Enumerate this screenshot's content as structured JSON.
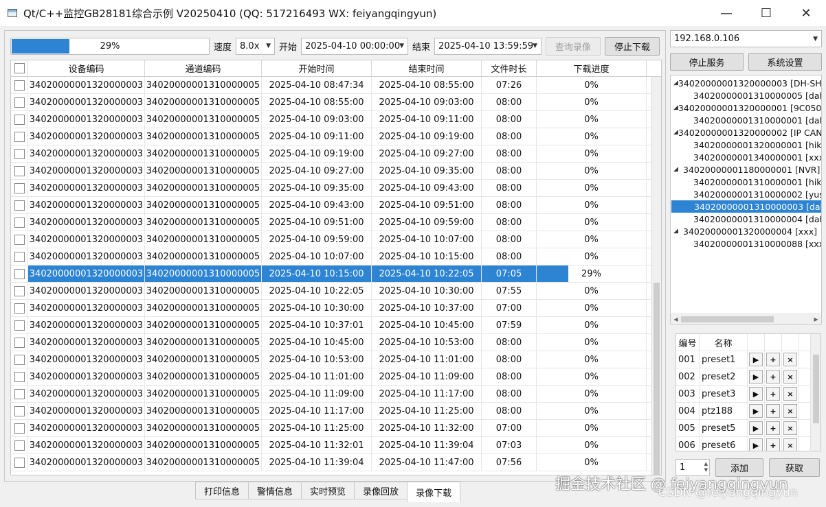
{
  "window": {
    "title": "Qt/C++监控GB28181综合示例 V20250410 (QQ: 517216493 WX: feiyangqingyun)",
    "minimize_glyph": "—",
    "maximize_glyph": "☐",
    "close_glyph": "✕"
  },
  "toolbar": {
    "progress_percent": 29,
    "progress_text": "29%",
    "speed_label": "速度",
    "speed_value": "8.0x",
    "start_label": "开始",
    "start_value": "2025-04-10 00:00:00",
    "end_label": "结束",
    "end_value": "2025-04-10 13:59:59",
    "query_button": "查询录像",
    "stop_download_button": "停止下载"
  },
  "table": {
    "headers": [
      "设备编码",
      "通道编码",
      "开始时间",
      "结束时间",
      "文件时长",
      "下载进度"
    ],
    "rows": [
      {
        "device": "34020000001320000003",
        "channel": "34020000001310000005",
        "start": "2025-04-10 08:47:34",
        "end": "2025-04-10 08:55:00",
        "duration": "07:26",
        "progress": "0%",
        "checked": false
      },
      {
        "device": "34020000001320000003",
        "channel": "34020000001310000005",
        "start": "2025-04-10 08:55:00",
        "end": "2025-04-10 09:03:00",
        "duration": "08:00",
        "progress": "0%",
        "checked": false
      },
      {
        "device": "34020000001320000003",
        "channel": "34020000001310000005",
        "start": "2025-04-10 09:03:00",
        "end": "2025-04-10 09:11:00",
        "duration": "08:00",
        "progress": "0%",
        "checked": false
      },
      {
        "device": "34020000001320000003",
        "channel": "34020000001310000005",
        "start": "2025-04-10 09:11:00",
        "end": "2025-04-10 09:19:00",
        "duration": "08:00",
        "progress": "0%",
        "checked": false
      },
      {
        "device": "34020000001320000003",
        "channel": "34020000001310000005",
        "start": "2025-04-10 09:19:00",
        "end": "2025-04-10 09:27:00",
        "duration": "08:00",
        "progress": "0%",
        "checked": false
      },
      {
        "device": "34020000001320000003",
        "channel": "34020000001310000005",
        "start": "2025-04-10 09:27:00",
        "end": "2025-04-10 09:35:00",
        "duration": "08:00",
        "progress": "0%",
        "checked": false
      },
      {
        "device": "34020000001320000003",
        "channel": "34020000001310000005",
        "start": "2025-04-10 09:35:00",
        "end": "2025-04-10 09:43:00",
        "duration": "08:00",
        "progress": "0%",
        "checked": false
      },
      {
        "device": "34020000001320000003",
        "channel": "34020000001310000005",
        "start": "2025-04-10 09:43:00",
        "end": "2025-04-10 09:51:00",
        "duration": "08:00",
        "progress": "0%",
        "checked": false
      },
      {
        "device": "34020000001320000003",
        "channel": "34020000001310000005",
        "start": "2025-04-10 09:51:00",
        "end": "2025-04-10 09:59:00",
        "duration": "08:00",
        "progress": "0%",
        "checked": false
      },
      {
        "device": "34020000001320000003",
        "channel": "34020000001310000005",
        "start": "2025-04-10 09:59:00",
        "end": "2025-04-10 10:07:00",
        "duration": "08:00",
        "progress": "0%",
        "checked": false
      },
      {
        "device": "34020000001320000003",
        "channel": "34020000001310000005",
        "start": "2025-04-10 10:07:00",
        "end": "2025-04-10 10:15:00",
        "duration": "08:00",
        "progress": "0%",
        "checked": false
      },
      {
        "device": "34020000001320000003",
        "channel": "34020000001310000005",
        "start": "2025-04-10 10:15:00",
        "end": "2025-04-10 10:22:05",
        "duration": "07:05",
        "progress": "29%",
        "progress_fraction": 0.29,
        "checked": true,
        "selected": true
      },
      {
        "device": "34020000001320000003",
        "channel": "34020000001310000005",
        "start": "2025-04-10 10:22:05",
        "end": "2025-04-10 10:30:00",
        "duration": "07:55",
        "progress": "0%",
        "checked": false
      },
      {
        "device": "34020000001320000003",
        "channel": "34020000001310000005",
        "start": "2025-04-10 10:30:00",
        "end": "2025-04-10 10:37:00",
        "duration": "07:00",
        "progress": "0%",
        "checked": false
      },
      {
        "device": "34020000001320000003",
        "channel": "34020000001310000005",
        "start": "2025-04-10 10:37:01",
        "end": "2025-04-10 10:45:00",
        "duration": "07:59",
        "progress": "0%",
        "checked": false
      },
      {
        "device": "34020000001320000003",
        "channel": "34020000001310000005",
        "start": "2025-04-10 10:45:00",
        "end": "2025-04-10 10:53:00",
        "duration": "08:00",
        "progress": "0%",
        "checked": false
      },
      {
        "device": "34020000001320000003",
        "channel": "34020000001310000005",
        "start": "2025-04-10 10:53:00",
        "end": "2025-04-10 11:01:00",
        "duration": "08:00",
        "progress": "0%",
        "checked": false
      },
      {
        "device": "34020000001320000003",
        "channel": "34020000001310000005",
        "start": "2025-04-10 11:01:00",
        "end": "2025-04-10 11:09:00",
        "duration": "08:00",
        "progress": "0%",
        "checked": false
      },
      {
        "device": "34020000001320000003",
        "channel": "34020000001310000005",
        "start": "2025-04-10 11:09:00",
        "end": "2025-04-10 11:17:00",
        "duration": "08:00",
        "progress": "0%",
        "checked": false
      },
      {
        "device": "34020000001320000003",
        "channel": "34020000001310000005",
        "start": "2025-04-10 11:17:00",
        "end": "2025-04-10 11:25:00",
        "duration": "08:00",
        "progress": "0%",
        "checked": false
      },
      {
        "device": "34020000001320000003",
        "channel": "34020000001310000005",
        "start": "2025-04-10 11:25:00",
        "end": "2025-04-10 11:32:00",
        "duration": "07:00",
        "progress": "0%",
        "checked": false
      },
      {
        "device": "34020000001320000003",
        "channel": "34020000001310000005",
        "start": "2025-04-10 11:32:01",
        "end": "2025-04-10 11:39:04",
        "duration": "07:03",
        "progress": "0%",
        "checked": false
      },
      {
        "device": "34020000001320000003",
        "channel": "34020000001310000005",
        "start": "2025-04-10 11:39:04",
        "end": "2025-04-10 11:47:00",
        "duration": "07:56",
        "progress": "0%",
        "checked": false
      }
    ]
  },
  "bottom_tabs": [
    "打印信息",
    "警情信息",
    "实时预览",
    "录像回放",
    "录像下载"
  ],
  "active_tab": "录像下载",
  "right_panel": {
    "ip_value": "192.168.0.106",
    "stop_service_button": "停止服务",
    "settings_button": "系统设置",
    "tree": [
      {
        "level": 0,
        "text": "34020000001320000003 [DH-SH"
      },
      {
        "level": 1,
        "text": "34020000001310000005 [dah"
      },
      {
        "level": 0,
        "text": "34020000001320000001 [9C050"
      },
      {
        "level": 1,
        "text": "34020000001310000001 [dah"
      },
      {
        "level": 0,
        "text": "34020000001320000002 [IP CAN"
      },
      {
        "level": 1,
        "text": "34020000001320000001 [hika"
      },
      {
        "level": 1,
        "text": "34020000001340000001 [xxx]"
      },
      {
        "level": 0,
        "text": "34020000001180000001 [NVR]"
      },
      {
        "level": 1,
        "text": "34020000001310000001 [hika"
      },
      {
        "level": 1,
        "text": "34020000001310000002 [yush"
      },
      {
        "level": 1,
        "text": "34020000001310000003 [dah",
        "selected": true
      },
      {
        "level": 1,
        "text": "34020000001310000004 [dah"
      },
      {
        "level": 0,
        "text": "34020000001320000004 [xxx]"
      },
      {
        "level": 1,
        "text": "34020000001310000088 [xxx]"
      }
    ],
    "preset_headers": [
      "编号",
      "名称"
    ],
    "presets": [
      {
        "id": "001",
        "name": "preset1"
      },
      {
        "id": "002",
        "name": "preset2"
      },
      {
        "id": "003",
        "name": "preset3"
      },
      {
        "id": "004",
        "name": "ptz188"
      },
      {
        "id": "005",
        "name": "preset5"
      },
      {
        "id": "006",
        "name": "preset6"
      }
    ],
    "preset_icons": {
      "play": "▶",
      "add": "+",
      "delete": "×"
    },
    "spin_value": "1",
    "add_button": "添加",
    "fetch_button": "获取"
  },
  "watermark": {
    "line1": "掘金技术社区 @ feiyangqingyun",
    "line2": "CSDN @feiyangqingyun"
  },
  "colors": {
    "accent": "#2d84d2",
    "selection": "#2d84d2"
  }
}
